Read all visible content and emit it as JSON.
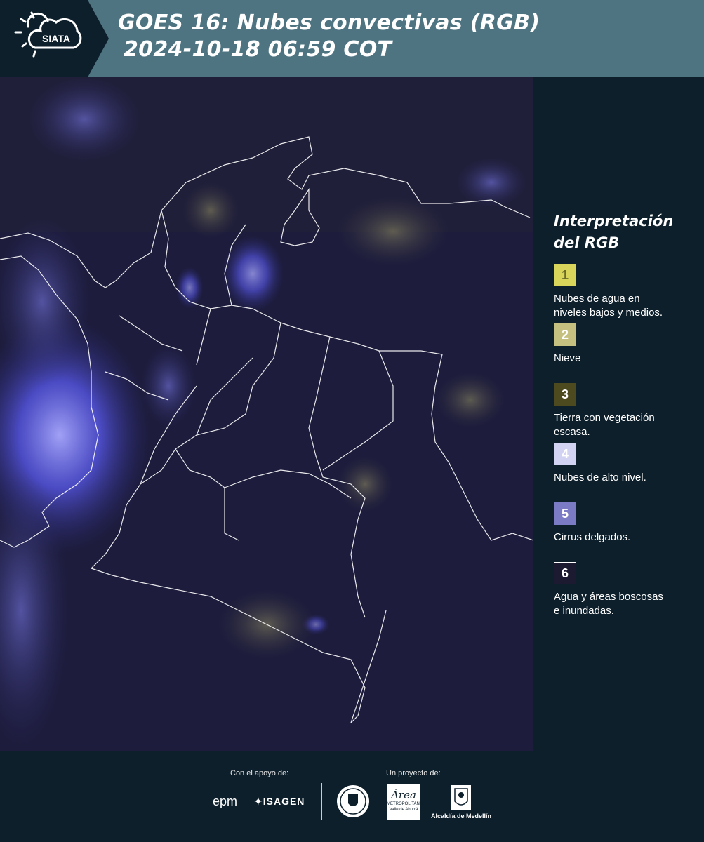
{
  "header": {
    "logo_text": "SIATA",
    "title_line1": "GOES 16: Nubes convectivas (RGB)",
    "title_line2": "2024-10-18 06:59 COT"
  },
  "legend": {
    "title_line1": "Interpretación",
    "title_line2": "del RGB",
    "items": [
      {
        "number": "1",
        "label_line1": "Nubes de agua en",
        "label_line2": "niveles bajos y medios.",
        "color": "#d9d55a",
        "text_color": "#6a6a2a"
      },
      {
        "number": "2",
        "label_line1": "Nieve",
        "label_line2": "",
        "color": "#c5c07f",
        "text_color": "#ffffff"
      },
      {
        "number": "3",
        "label_line1": "Tierra con vegetación",
        "label_line2": "escasa.",
        "color": "#4d4a1f",
        "text_color": "#ffffff"
      },
      {
        "number": "4",
        "label_line1": "Nubes de alto nivel.",
        "label_line2": "",
        "color": "#d2d2f2",
        "text_color": "#ffffff"
      },
      {
        "number": "5",
        "label_line1": "Cirrus delgados.",
        "label_line2": "",
        "color": "#7b7ac4",
        "text_color": "#ffffff"
      },
      {
        "number": "6",
        "label_line1": "Agua y áreas boscosas",
        "label_line2": "e inundadas.",
        "color": "#1b1a30",
        "text_color": "#ffffff"
      }
    ]
  },
  "footer": {
    "support_label": "Con el apoyo de:",
    "project_label": "Un proyecto de:",
    "epm_logo": "epm",
    "isagen_logo": "ISAGEN",
    "area_logo": "Área",
    "area_sub": "METROPOLITANA",
    "area_sub2": "Valle de Aburrá",
    "alcaldia_logo": "Alcaldía de Medellín"
  }
}
